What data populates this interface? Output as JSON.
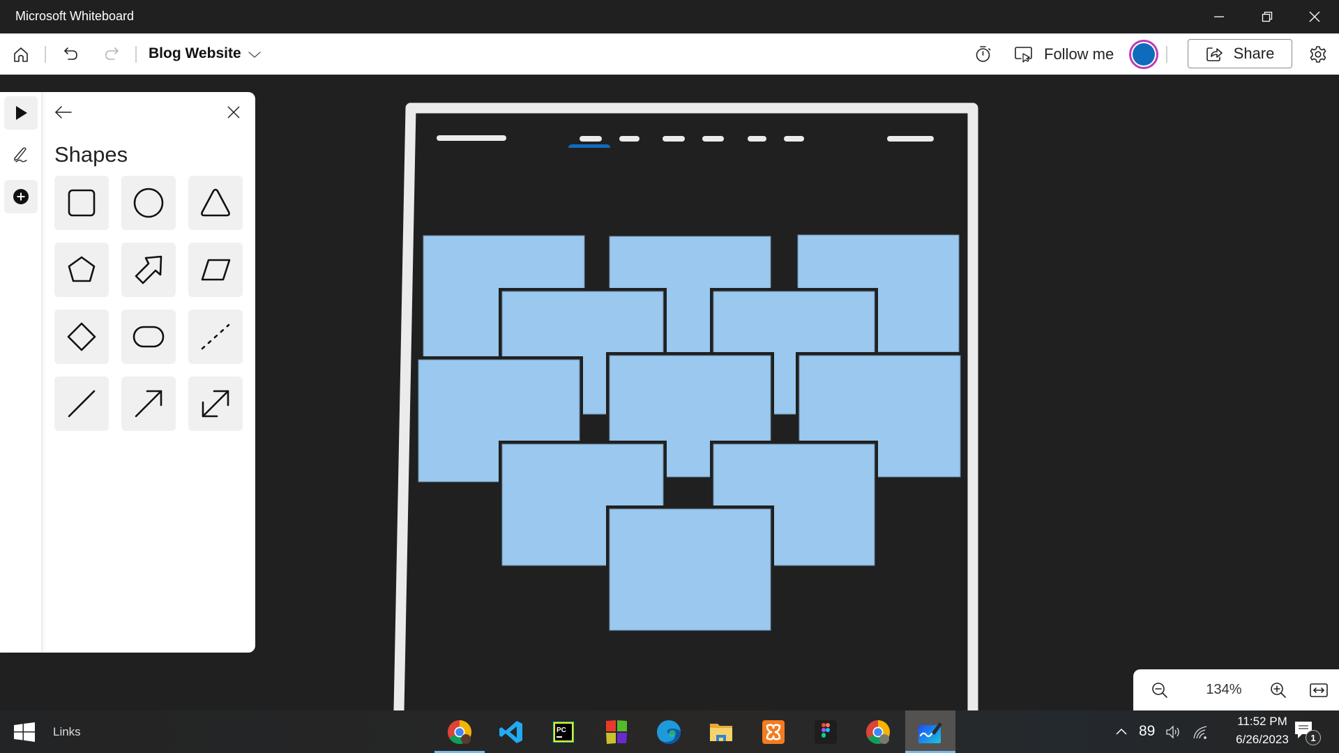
{
  "window": {
    "title": "Microsoft Whiteboard",
    "controls": [
      "minimize",
      "restore",
      "close"
    ]
  },
  "toolbar": {
    "home_icon": "home-icon",
    "undo_icon": "undo-icon",
    "redo_icon": "redo-icon",
    "board_name": "Blog Website",
    "board_dropdown_icon": "chevron-down-icon",
    "timer_icon": "timer-icon",
    "follow_label": "Follow me",
    "share_label": "Share",
    "settings_icon": "gear-icon",
    "avatar_color": "#0f6cbd",
    "avatar_ring_color": "#c239b3"
  },
  "rail": {
    "tools": [
      {
        "name": "select",
        "icon": "pointer-icon",
        "selected": true
      },
      {
        "name": "inking",
        "icon": "pen-icon",
        "selected": false
      },
      {
        "name": "create",
        "icon": "add-icon",
        "selected": true
      }
    ]
  },
  "shapes_panel": {
    "title": "Shapes",
    "shapes": [
      "rounded-square",
      "circle",
      "triangle",
      "pentagon",
      "block-arrow",
      "parallelogram",
      "diamond",
      "stadium",
      "dashed-line",
      "line",
      "arrow",
      "double-arrow"
    ]
  },
  "canvas": {
    "background": "#202020",
    "frame_color": "#ebebeb",
    "card_color": "#9ac8ee",
    "nav_accent": "#0f6cbd",
    "card_count": 11
  },
  "zoom": {
    "level": "134%"
  },
  "taskbar": {
    "links_label": "Links",
    "apps": [
      {
        "name": "Google Chrome (profile 1)",
        "icon": "chrome-icon"
      },
      {
        "name": "Visual Studio Code",
        "icon": "vscode-icon"
      },
      {
        "name": "PyCharm",
        "icon": "pycharm-icon"
      },
      {
        "name": "Microsoft Store",
        "icon": "store-icon"
      },
      {
        "name": "Microsoft Edge",
        "icon": "edge-icon"
      },
      {
        "name": "File Explorer",
        "icon": "folder-icon"
      },
      {
        "name": "XAMPP",
        "icon": "xampp-icon"
      },
      {
        "name": "Figma",
        "icon": "figma-icon"
      },
      {
        "name": "Google Chrome (profile 2)",
        "icon": "chrome-icon"
      },
      {
        "name": "Microsoft Whiteboard",
        "icon": "whiteboard-icon",
        "active": true
      }
    ],
    "battery": "89",
    "time": "11:52 PM",
    "date": "6/26/2023",
    "notifications": "1"
  }
}
